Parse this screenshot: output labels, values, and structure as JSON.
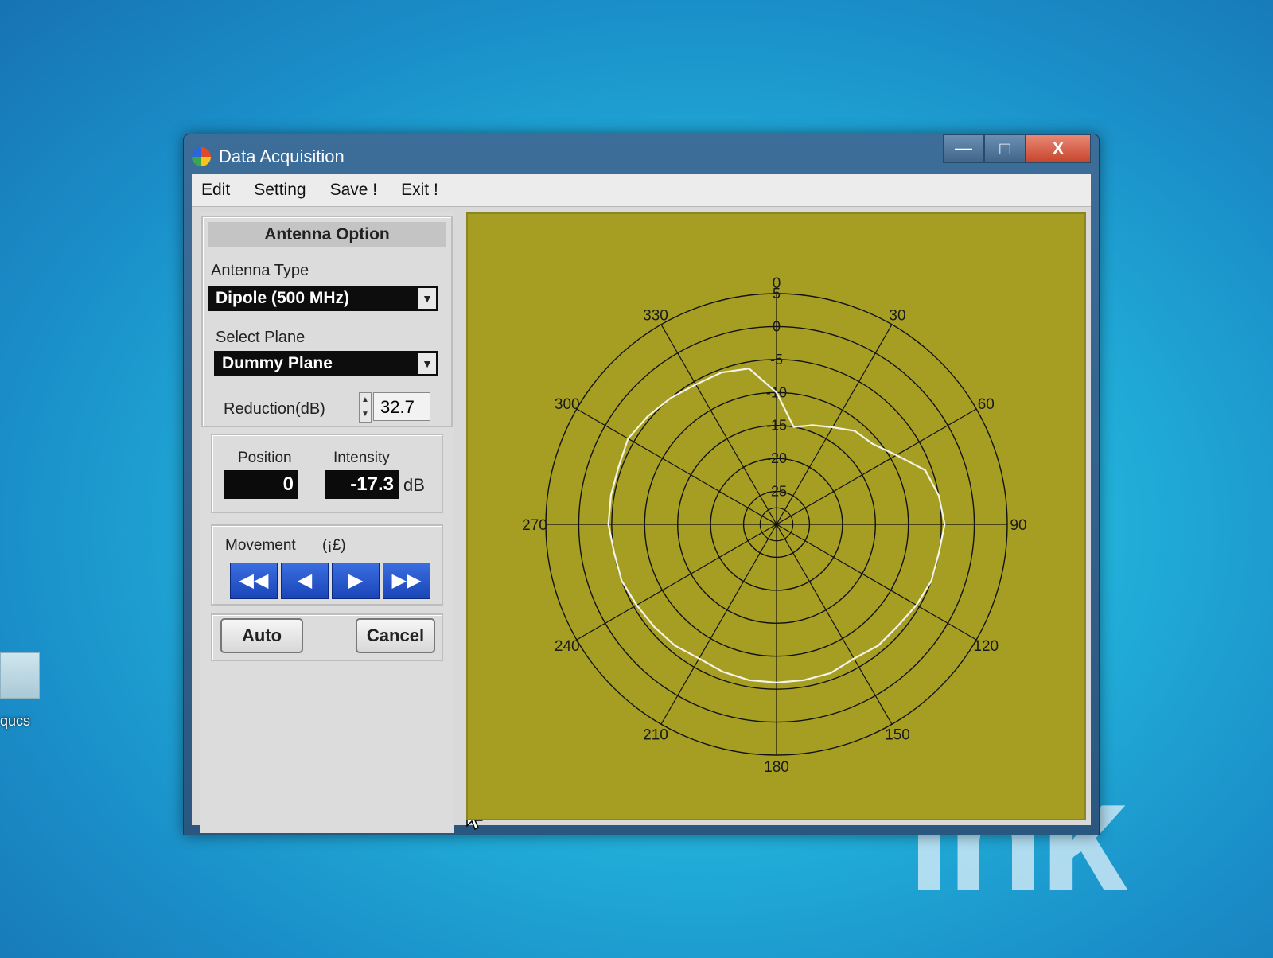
{
  "desktop": {
    "icon_label": "qucs",
    "brand_text": "ink"
  },
  "window": {
    "title": "Data Acquisition",
    "buttons": {
      "minimize": "—",
      "maximize": "□",
      "close": "X"
    }
  },
  "menu": [
    "Edit",
    "Setting",
    "Save !",
    "Exit !"
  ],
  "antenna_option": {
    "title": "Antenna Option",
    "antenna_type_label": "Antenna Type",
    "antenna_type_value": "Dipole (500 MHz)",
    "select_plane_label": "Select Plane",
    "select_plane_value": "Dummy Plane",
    "reduction_label": "Reduction(dB)",
    "reduction_value": "32.7"
  },
  "readouts": {
    "position_label": "Position",
    "position_value": "0",
    "intensity_label": "Intensity",
    "intensity_value": "-17.3",
    "intensity_unit": "dB"
  },
  "movement": {
    "label": "Movement",
    "extra": "(¡£)"
  },
  "buttons": {
    "auto": "Auto",
    "cancel": "Cancel"
  },
  "colors": {
    "plot_background": "#a69e23",
    "trace": "#f4f4ea",
    "grid": "#111111"
  },
  "chart_data": {
    "type": "polar",
    "angle_labels": [
      "0",
      "30",
      "60",
      "90",
      "120",
      "150",
      "180",
      "210",
      "240",
      "270",
      "300",
      "330"
    ],
    "radial_labels": [
      "5",
      "0",
      "-5",
      "-10",
      "-15",
      "-20",
      "-25"
    ],
    "rlim": [
      -30,
      5
    ],
    "series": [
      {
        "angles": [
          0,
          10,
          20,
          30,
          40,
          50,
          60,
          70,
          80,
          90,
          100,
          110,
          120,
          130,
          140,
          150,
          160,
          170,
          180,
          190,
          200,
          210,
          220,
          230,
          240,
          250,
          260,
          270,
          280,
          290,
          300,
          310,
          320,
          330,
          340,
          350
        ],
        "values": [
          -10,
          -15,
          -14,
          -13,
          -11.5,
          -11,
          -9,
          -6,
          -5,
          -4.5,
          -5,
          -5,
          -5.5,
          -6,
          -6,
          -6.5,
          -6,
          -6,
          -6,
          -6,
          -6.2,
          -6.5,
          -6,
          -5.8,
          -5.5,
          -5,
          -5,
          -4.5,
          -4.5,
          -4.5,
          -4,
          -4.5,
          -5,
          -5.5,
          -5.5,
          -6
        ]
      }
    ]
  }
}
